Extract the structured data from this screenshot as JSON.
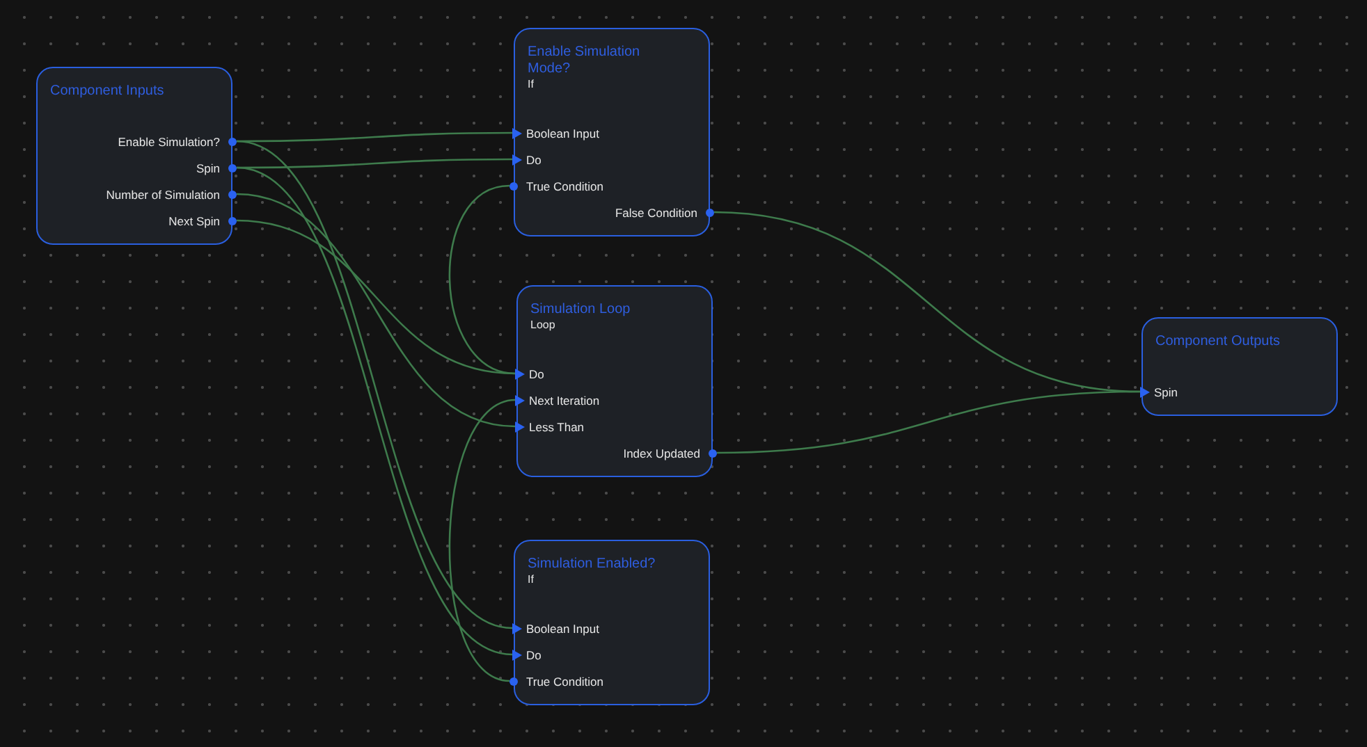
{
  "nodes": [
    {
      "title": "Component Inputs",
      "outputs": [
        {
          "label": "Enable Simulation?"
        },
        {
          "label": "Spin"
        },
        {
          "label": "Number of Simulation"
        },
        {
          "label": "Next Spin"
        }
      ]
    },
    {
      "title": "Enable Simulation Mode?",
      "subtitle": "If",
      "inputs": [
        {
          "label": "Boolean Input",
          "kind": "arrow"
        },
        {
          "label": "Do",
          "kind": "arrow"
        },
        {
          "label": "True Condition",
          "kind": "dot"
        }
      ],
      "outputs": [
        {
          "label": "False Condition"
        }
      ]
    },
    {
      "title": "Simulation Loop",
      "subtitle": "Loop",
      "inputs": [
        {
          "label": "Do",
          "kind": "arrow"
        },
        {
          "label": "Next Iteration",
          "kind": "arrow"
        },
        {
          "label": "Less Than",
          "kind": "arrow"
        }
      ],
      "outputs": [
        {
          "label": "Index Updated"
        }
      ]
    },
    {
      "title": "Simulation Enabled?",
      "subtitle": "If",
      "inputs": [
        {
          "label": "Boolean Input",
          "kind": "arrow"
        },
        {
          "label": "Do",
          "kind": "arrow"
        },
        {
          "label": "True Condition",
          "kind": "dot"
        }
      ]
    },
    {
      "title": "Component Outputs",
      "inputs": [
        {
          "label": "Spin",
          "kind": "arrow"
        }
      ]
    }
  ]
}
